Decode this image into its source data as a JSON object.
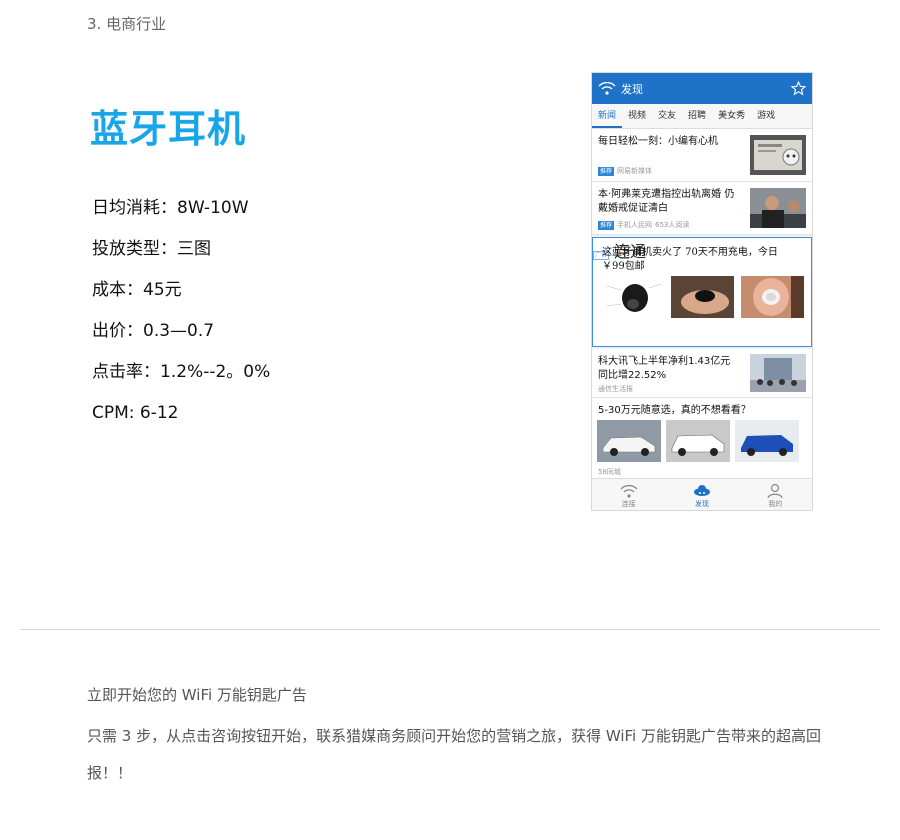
{
  "section_title": "3. 电商行业",
  "product_title": "蓝牙耳机",
  "stats": [
    "日均消耗：8W-10W",
    "投放类型：三图",
    "成本：45元",
    "出价：0.3—0.7",
    "点击率：1.2%--2。0%",
    "CPM: 6-12"
  ],
  "phone": {
    "header_title": "发现",
    "tabs": [
      "新闻",
      "视频",
      "交友",
      "招聘",
      "美女秀",
      "游戏"
    ],
    "news": [
      {
        "headline": "每日轻松一刻：小编有心机",
        "tag": "推荐",
        "source": "网易新媒体",
        "reads": ""
      },
      {
        "headline": "本·阿弗莱克遭指控出轨离婚 仍戴婚戒促证清白",
        "tag": "推荐",
        "source": "手机人民网",
        "reads": "653人阅读"
      }
    ],
    "ad": {
      "headline": "这蓝牙耳机卖火了 70天不用充电，今日 ￥99包邮",
      "tag": "广告",
      "source": "连通"
    },
    "news2": {
      "headline": "科大讯飞上半年净利1.43亿元 同比增22.52%",
      "source": "通信生活报"
    },
    "cars": {
      "headline": "5-30万元随意选，真的不想看看？",
      "source": "58同城"
    },
    "bottom_nav": [
      "连接",
      "发现",
      "我的"
    ],
    "accent": "#1e73c8"
  },
  "cta": {
    "title": "立即开始您的 WiFi 万能钥匙广告",
    "body": "只需 3 步，从点击咨询按钮开始，联系猎媒商务顾问开始您的营销之旅，获得 WiFi 万能钥匙广告带来的超高回报！！"
  }
}
